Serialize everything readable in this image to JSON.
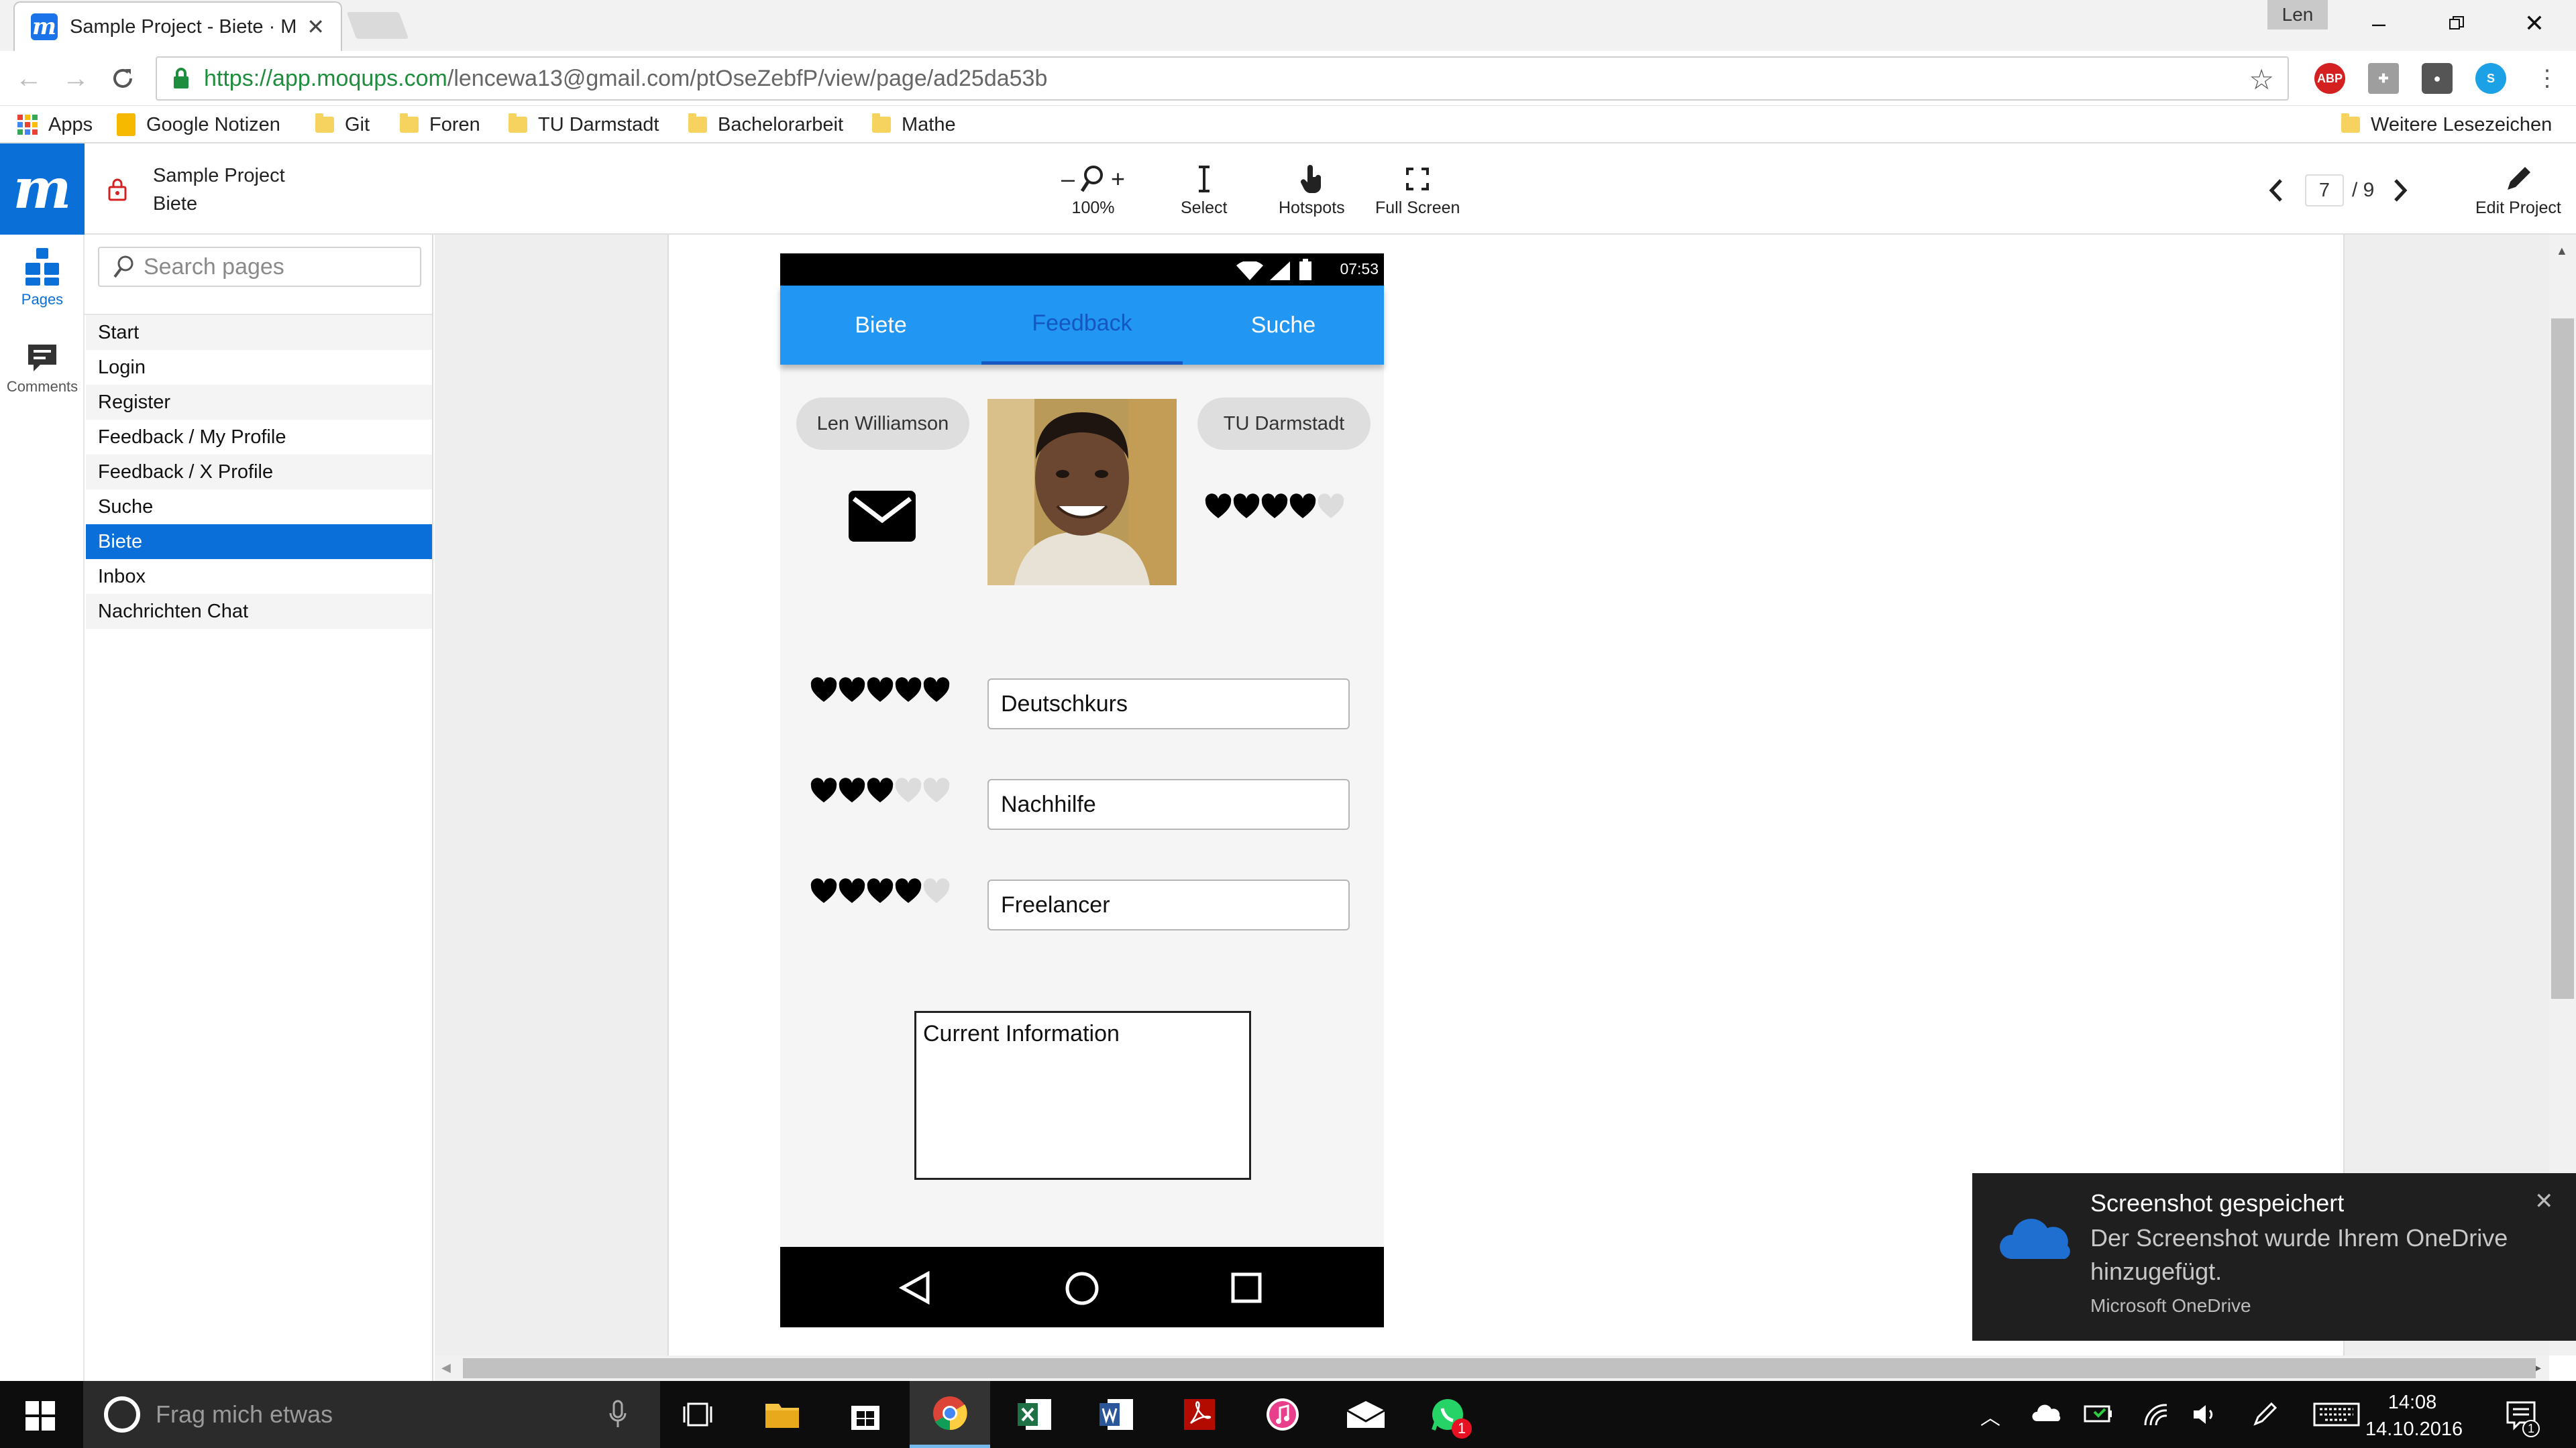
{
  "browser": {
    "tab_title": "Sample Project - Biete · M",
    "profile_name": "Len",
    "url_scheme_host": "https://app.moqups.com",
    "url_path": "/lencewa13@gmail.com/ptOseZebfP/view/page/ad25da53b",
    "bookmarks": [
      {
        "label": "Apps",
        "icon": "apps-grid-icon"
      },
      {
        "label": "Google Notizen",
        "icon": "keep-icon"
      },
      {
        "label": "Git",
        "icon": "folder-icon"
      },
      {
        "label": "Foren",
        "icon": "folder-icon"
      },
      {
        "label": "TU Darmstadt",
        "icon": "folder-icon"
      },
      {
        "label": "Bachelorarbeit",
        "icon": "folder-icon"
      },
      {
        "label": "Mathe",
        "icon": "folder-icon"
      }
    ],
    "other_bookmarks": "Weitere Lesezeichen"
  },
  "moqups": {
    "project_name": "Sample Project",
    "page_name": "Biete",
    "zoom": "100%",
    "tools": {
      "select": "Select",
      "hotspots": "Hotspots",
      "fullscreen": "Full Screen",
      "edit": "Edit Project"
    },
    "page_current": "7",
    "page_total": "/ 9",
    "rail": {
      "pages": "Pages",
      "comments": "Comments"
    },
    "search_placeholder": "Search pages",
    "pages": [
      "Start",
      "Login",
      "Register",
      "Feedback / My Profile",
      "Feedback / X Profile",
      "Suche",
      "Biete",
      "Inbox",
      "Nachrichten Chat"
    ],
    "active_page_index": 6
  },
  "mockup": {
    "time": "07:53",
    "tabs": [
      "Biete",
      "Feedback",
      "Suche"
    ],
    "selected_tab_index": 1,
    "name": "Len Williamson",
    "university": "TU Darmstadt",
    "rating": 4,
    "rating_max": 5,
    "skills": [
      {
        "label": "Deutschkurs",
        "rating": 5
      },
      {
        "label": "Nachhilfe",
        "rating": 3
      },
      {
        "label": "Freelancer",
        "rating": 4
      }
    ],
    "info_box": "Current Information"
  },
  "toast": {
    "title": "Screenshot gespeichert",
    "body": "Der Screenshot wurde Ihrem OneDrive hinzugefügt.",
    "source": "Microsoft OneDrive"
  },
  "taskbar": {
    "search_placeholder": "Frag mich etwas",
    "time": "14:08",
    "date": "14.10.2016",
    "notification_count": "1",
    "whatsapp_badge": "1"
  },
  "colors": {
    "moqups_blue": "#0b6fd8",
    "mockup_tabbar": "#2196f3",
    "mockup_tab_selected": "#1557c0"
  }
}
